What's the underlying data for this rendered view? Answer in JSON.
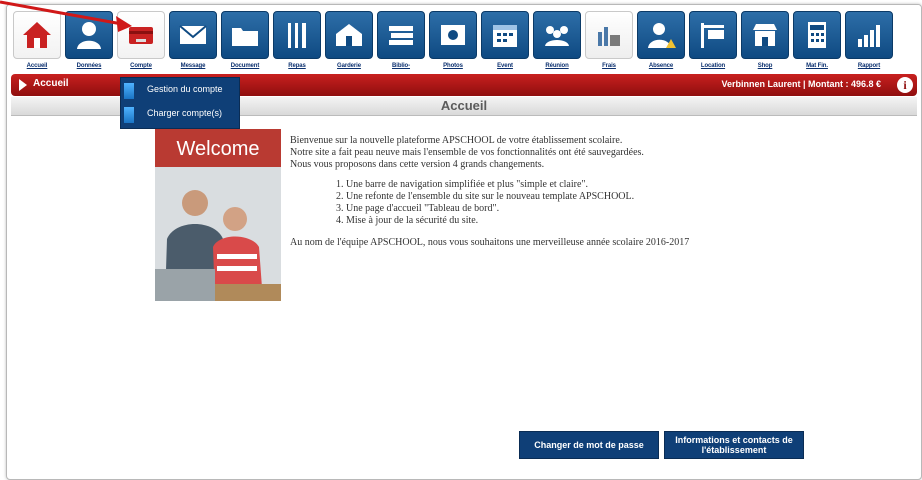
{
  "toolbar": {
    "items": [
      {
        "label": "Accueil",
        "icon": "home-icon"
      },
      {
        "label": "Données",
        "icon": "user-icon"
      },
      {
        "label": "Compte",
        "icon": "wallet-icon"
      },
      {
        "label": "Message",
        "icon": "envelope-icon"
      },
      {
        "label": "Document",
        "icon": "folder-icon"
      },
      {
        "label": "Repas",
        "icon": "cutlery-icon"
      },
      {
        "label": "Garderie",
        "icon": "house-care-icon"
      },
      {
        "label": "Biblio-",
        "icon": "books-icon"
      },
      {
        "label": "Photos",
        "icon": "photos-icon"
      },
      {
        "label": "Event",
        "icon": "calendar-icon"
      },
      {
        "label": "Réunion",
        "icon": "meeting-icon"
      },
      {
        "label": "Frais",
        "icon": "fees-icon"
      },
      {
        "label": "Absence",
        "icon": "absence-icon"
      },
      {
        "label": "Location",
        "icon": "for-rent-icon"
      },
      {
        "label": "Shop",
        "icon": "shop-icon"
      },
      {
        "label": "Mat Fin.",
        "icon": "calculator-icon"
      },
      {
        "label": "Rapport",
        "icon": "chart-icon"
      }
    ]
  },
  "breadcrumb": {
    "label": "Accueil"
  },
  "user_info": "Verbinnen Laurent | Montant : 496.8 €",
  "page_title": "Accueil",
  "dropdown": {
    "items": [
      "Gestion du compte",
      "Charger compte(s)"
    ]
  },
  "welcome_image": {
    "label": "Welcome"
  },
  "intro": {
    "p1": "Bienvenue sur la nouvelle plateforme APSCHOOL de votre établissement scolaire.",
    "p2": "Notre site a fait peau neuve mais l'ensemble de vos fonctionnalités ont été sauvegardées.",
    "p3": "Nous vous proposons dans cette version 4 grands changements.",
    "list": [
      "Une barre de navigation simplifiée et plus \"simple et claire\".",
      "Une refonte de l'ensemble du site sur le nouveau template APSCHOOL.",
      "Une page d'accueil \"Tableau de bord\".",
      "Mise à jour de la sécurité du site."
    ],
    "closing": "Au nom de l'équipe APSCHOOL, nous vous souhaitons une merveilleuse année scolaire 2016-2017"
  },
  "buttons": {
    "change_password": "Changer de mot de passe",
    "info_contacts": "Informations et contacts de l'établissement"
  },
  "colors": {
    "accent_red": "#b3191a",
    "nav_blue": "#0f3f77",
    "annotation_arrow": "#d01818"
  }
}
